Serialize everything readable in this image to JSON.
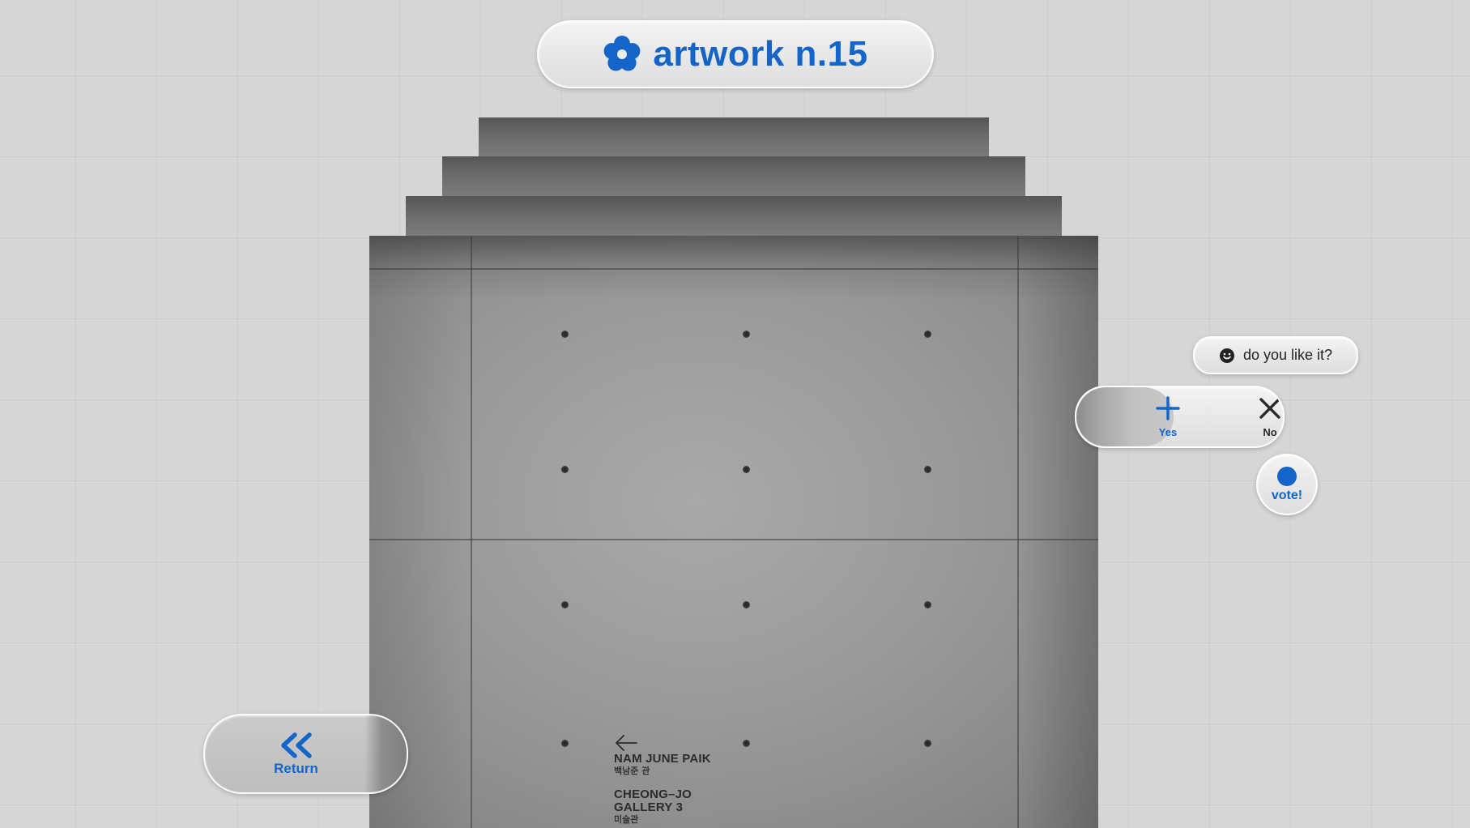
{
  "header": {
    "icon": "flower-icon",
    "title": "artwork n.15"
  },
  "artwork": {
    "sign": {
      "arrow_icon": "arrow-left-icon",
      "line1": "NAM JUNE PAIK",
      "line1_sub": "백남준 관",
      "line2": "CHEONG–JO",
      "line3": "GALLERY 3",
      "line3_sub": "미술관"
    }
  },
  "feedback": {
    "question_icon": "smiley-icon",
    "question": "do you like it?",
    "yes_icon": "plus-icon",
    "yes_label": "Yes",
    "no_icon": "close-icon",
    "no_label": "No",
    "submit_icon": "dot-icon",
    "submit_label": "vote!"
  },
  "navigation": {
    "return_icon": "double-chevron-left-icon",
    "return_label": "Return"
  },
  "colors": {
    "accent": "#1565c8",
    "background": "#d6d6d6",
    "text_dark": "#222222"
  }
}
